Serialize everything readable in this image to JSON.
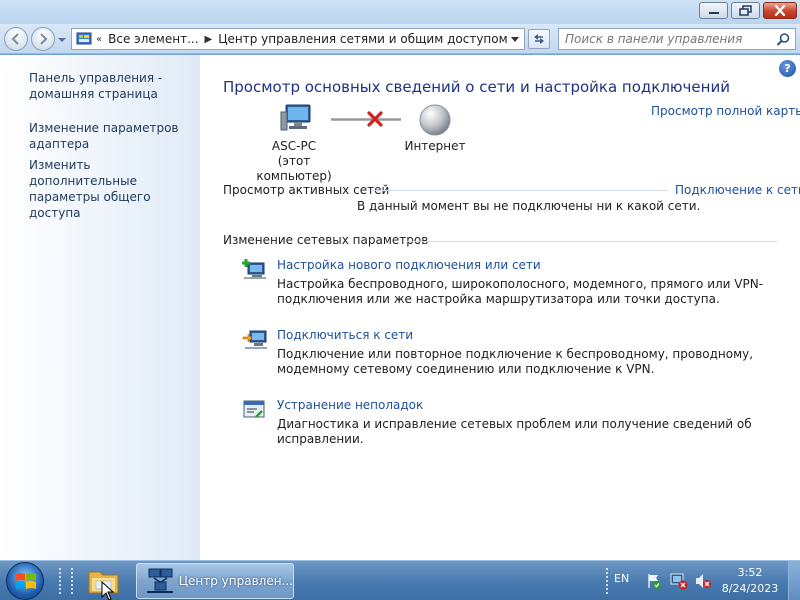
{
  "window": {
    "breadcrumb": [
      "Все элемент...",
      "Центр управления сетями и общим доступом"
    ],
    "search_placeholder": "Поиск в панели управления"
  },
  "sidebar": {
    "links": [
      "Панель управления - домашняя страница",
      "Изменение параметров адаптера",
      "Изменить дополнительные параметры общего доступа"
    ]
  },
  "main": {
    "title": "Просмотр основных сведений о сети и настройка подключений",
    "full_map_link": "Просмотр полной карты",
    "computer_name": "ASC-PC",
    "computer_caption": "(этот компьютер)",
    "internet_label": "Интернет",
    "active_networks_header": "Просмотр активных сетей",
    "connect_link": "Подключение к сети",
    "not_connected_text": "В данный момент вы не подключены ни к какой сети.",
    "change_settings_header": "Изменение сетевых параметров",
    "tasks": [
      {
        "title": "Настройка нового подключения или сети",
        "description": "Настройка беспроводного, широкополосного, модемного, прямого или VPN-подключения или же настройка маршрутизатора или точки доступа."
      },
      {
        "title": "Подключиться к сети",
        "description": "Подключение или повторное подключение к беспроводному, проводному, модемному сетевому соединению или подключение к VPN."
      },
      {
        "title": "Устранение неполадок",
        "description": "Диагностика и исправление сетевых проблем или получение сведений об исправлении."
      }
    ]
  },
  "taskbar": {
    "active_window_label": "Центр управлен...",
    "language": "EN",
    "time": "3:52",
    "date": "8/24/2023"
  },
  "colors": {
    "link": "#1e4f9c",
    "title": "#1e3287",
    "taskbar": "#4b7cb1"
  }
}
